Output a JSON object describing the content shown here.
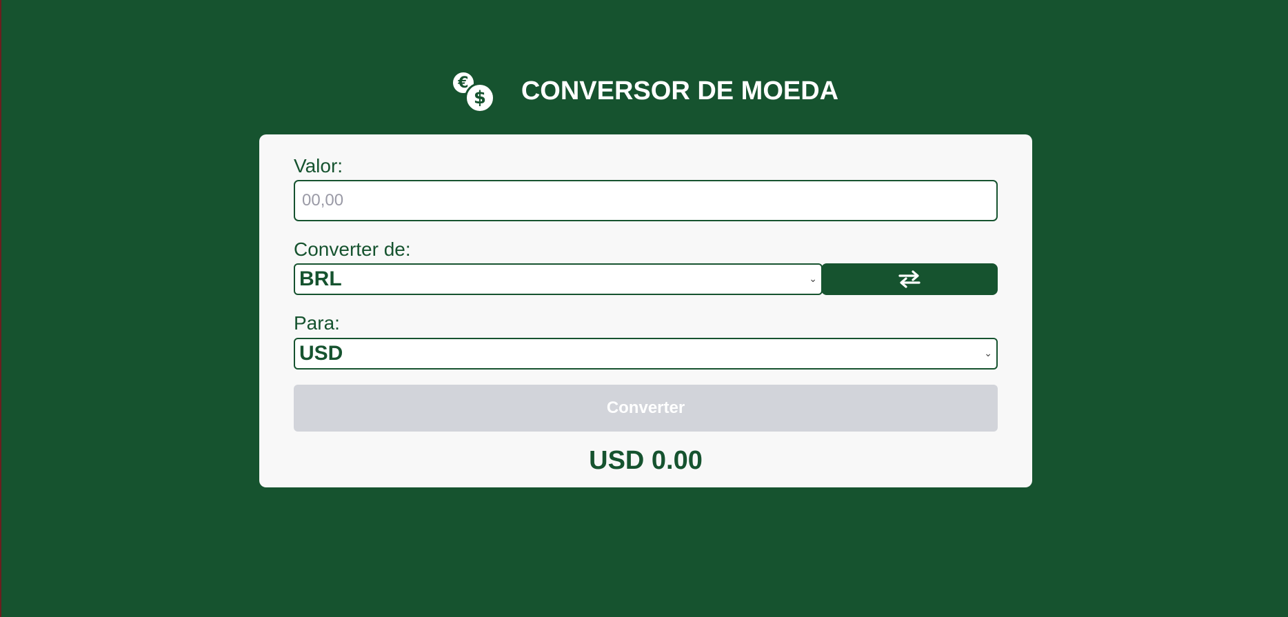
{
  "header": {
    "title": "CONVERSOR DE MOEDA",
    "logo_icon": "currency-coins-icon",
    "euro_symbol": "€",
    "dollar_symbol": "$"
  },
  "form": {
    "value_label": "Valor:",
    "value_input": "",
    "value_placeholder": "00,00",
    "from_label": "Converter de:",
    "from_selected": "BRL",
    "swap_icon": "swap-arrows-icon",
    "to_label": "Para:",
    "to_selected": "USD",
    "convert_button": "Converter",
    "result": "USD 0.00"
  },
  "colors": {
    "background": "#16532f",
    "card": "#f8f8f8",
    "accent": "#16532f",
    "disabled_button": "#d2d4da"
  }
}
